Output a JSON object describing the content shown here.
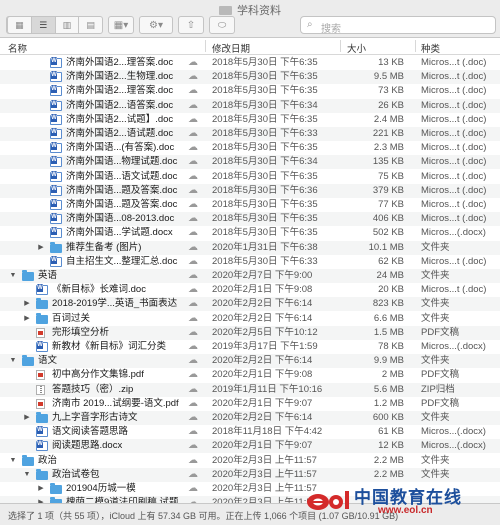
{
  "window": {
    "title": "学科资料"
  },
  "toolbar": {
    "views": [
      "icon-view",
      "list-view",
      "column-view",
      "gallery-view"
    ],
    "group_icon": "gear-icon",
    "share_icon": "share-icon",
    "tag_icon": "tag-icon",
    "search": {
      "placeholder": "搜索"
    }
  },
  "columns": {
    "name": "名称",
    "date": "修改日期",
    "size": "大小",
    "kind": "种类"
  },
  "rows": [
    {
      "level": 2,
      "type": "doc",
      "name": "济南外国语2...理答案.doc",
      "date": "2018年5月30日 下午6:35",
      "size": "13 KB",
      "kind": "Micros...t (.doc)"
    },
    {
      "level": 2,
      "type": "doc",
      "name": "济南外国语2...生物理.doc",
      "date": "2018年5月30日 下午6:35",
      "size": "9.5 MB",
      "kind": "Micros...t (.doc)"
    },
    {
      "level": 2,
      "type": "doc",
      "name": "济南外国语2...理答案.doc",
      "date": "2018年5月30日 下午6:35",
      "size": "73 KB",
      "kind": "Micros...t (.doc)"
    },
    {
      "level": 2,
      "type": "doc",
      "name": "济南外国语2...语答案.doc",
      "date": "2018年5月30日 下午6:34",
      "size": "26 KB",
      "kind": "Micros...t (.doc)"
    },
    {
      "level": 2,
      "type": "doc",
      "name": "济南外国语2...试题】.doc",
      "date": "2018年5月30日 下午6:35",
      "size": "2.4 MB",
      "kind": "Micros...t (.doc)"
    },
    {
      "level": 2,
      "type": "doc",
      "name": "济南外国语2...语试题.doc",
      "date": "2018年5月30日 下午6:33",
      "size": "221 KB",
      "kind": "Micros...t (.doc)"
    },
    {
      "level": 2,
      "type": "doc",
      "name": "济南外国语...(有答案).doc",
      "date": "2018年5月30日 下午6:35",
      "size": "2.3 MB",
      "kind": "Micros...t (.doc)"
    },
    {
      "level": 2,
      "type": "doc",
      "name": "济南外国语...物理试题.doc",
      "date": "2018年5月30日 下午6:34",
      "size": "135 KB",
      "kind": "Micros...t (.doc)"
    },
    {
      "level": 2,
      "type": "doc",
      "name": "济南外国语...语文试题.doc",
      "date": "2018年5月30日 下午6:35",
      "size": "75 KB",
      "kind": "Micros...t (.doc)"
    },
    {
      "level": 2,
      "type": "doc",
      "name": "济南外国语...题及答案.doc",
      "date": "2018年5月30日 下午6:36",
      "size": "379 KB",
      "kind": "Micros...t (.doc)"
    },
    {
      "level": 2,
      "type": "doc",
      "name": "济南外国语...题及答案.doc",
      "date": "2018年5月30日 下午6:35",
      "size": "77 KB",
      "kind": "Micros...t (.doc)"
    },
    {
      "level": 2,
      "type": "doc",
      "name": "济南外国语...08-2013.doc",
      "date": "2018年5月30日 下午6:35",
      "size": "406 KB",
      "kind": "Micros...t (.doc)"
    },
    {
      "level": 2,
      "type": "doc",
      "name": "济南外国语...学试题.docx",
      "date": "2018年5月30日 下午6:35",
      "size": "502 KB",
      "kind": "Micros...(.docx)"
    },
    {
      "level": 2,
      "type": "folder",
      "collapsed": true,
      "name": "推荐生备考 (图片)",
      "date": "2020年1月31日 下午6:38",
      "size": "10.1 MB",
      "kind": "文件夹"
    },
    {
      "level": 2,
      "type": "doc",
      "name": "自主招生文...整理汇总.doc",
      "date": "2018年5月30日 下午6:33",
      "size": "62 KB",
      "kind": "Micros...t (.doc)"
    },
    {
      "level": 0,
      "type": "folder",
      "expanded": true,
      "name": "英语",
      "date": "2020年2月7日 下午9:00",
      "size": "24 MB",
      "kind": "文件夹"
    },
    {
      "level": 1,
      "type": "doc",
      "name": "《新目标》长难词.doc",
      "date": "2020年2月1日 下午9:08",
      "size": "20 KB",
      "kind": "Micros...t (.doc)"
    },
    {
      "level": 1,
      "type": "folder",
      "collapsed": true,
      "name": "2018-2019学...英语_书面表达",
      "date": "2020年2月2日 下午6:14",
      "size": "823 KB",
      "kind": "文件夹"
    },
    {
      "level": 1,
      "type": "folder",
      "collapsed": true,
      "name": "百词过关",
      "date": "2020年2月2日 下午6:14",
      "size": "6.6 MB",
      "kind": "文件夹"
    },
    {
      "level": 1,
      "type": "pdf",
      "name": "完形填空分析",
      "date": "2020年2月5日 下午10:12",
      "size": "1.5 MB",
      "kind": "PDF文稿"
    },
    {
      "level": 1,
      "type": "doc",
      "name": "新教材《新目标》词汇分类",
      "date": "2019年3月17日 下午1:59",
      "size": "78 KB",
      "kind": "Micros...(.docx)"
    },
    {
      "level": 0,
      "type": "folder",
      "expanded": true,
      "name": "语文",
      "date": "2020年2月2日 下午6:14",
      "size": "9.9 MB",
      "kind": "文件夹"
    },
    {
      "level": 1,
      "type": "pdf",
      "name": "初中高分作文集锦.pdf",
      "date": "2020年2月1日 下午9:08",
      "size": "2 MB",
      "kind": "PDF文稿"
    },
    {
      "level": 1,
      "type": "zip",
      "name": "答题技巧（密）.zip",
      "date": "2019年1月11日 下午10:16",
      "size": "5.6 MB",
      "kind": "ZIP归档"
    },
    {
      "level": 1,
      "type": "pdf",
      "name": "济南市 2019...试纲要-语文.pdf",
      "date": "2020年2月1日 下午9:07",
      "size": "1.2 MB",
      "kind": "PDF文稿"
    },
    {
      "level": 1,
      "type": "folder",
      "collapsed": true,
      "name": "九上字音字形古诗文",
      "date": "2020年2月2日 下午6:14",
      "size": "600 KB",
      "kind": "文件夹"
    },
    {
      "level": 1,
      "type": "doc",
      "name": "语文阅读答题思路",
      "date": "2018年11月18日 下午4:42",
      "size": "61 KB",
      "kind": "Micros...(.docx)"
    },
    {
      "level": 1,
      "type": "doc",
      "name": "阅读题思路.docx",
      "date": "2020年2月1日 下午9:07",
      "size": "12 KB",
      "kind": "Micros...(.docx)"
    },
    {
      "level": 0,
      "type": "folder",
      "expanded": true,
      "name": "政治",
      "date": "2020年2月3日 上午11:57",
      "size": "2.2 MB",
      "kind": "文件夹"
    },
    {
      "level": 1,
      "type": "folder",
      "expanded": true,
      "name": "政治试卷包",
      "date": "2020年2月3日 上午11:57",
      "size": "2.2 MB",
      "kind": "文件夹"
    },
    {
      "level": 2,
      "type": "folder",
      "collapsed": true,
      "name": "201904历城一模",
      "date": "2020年2月3日 上午11:57",
      "size": "",
      "kind": ""
    },
    {
      "level": 2,
      "type": "folder",
      "collapsed": true,
      "name": "槐荫二模9道法印刷稿 试题",
      "date": "2020年2月3日 上午11:57",
      "size": "",
      "kind": ""
    }
  ],
  "status": {
    "text": "选择了 1 项（共 55 项），iCloud 上有 57.34 GB 可用。正在上传 1,066 个项目 (1.07 GB/10.91 GB)"
  },
  "watermark": {
    "brand": "中国教育在线",
    "url": "www.eol.cn",
    "logo_text": "eol"
  }
}
